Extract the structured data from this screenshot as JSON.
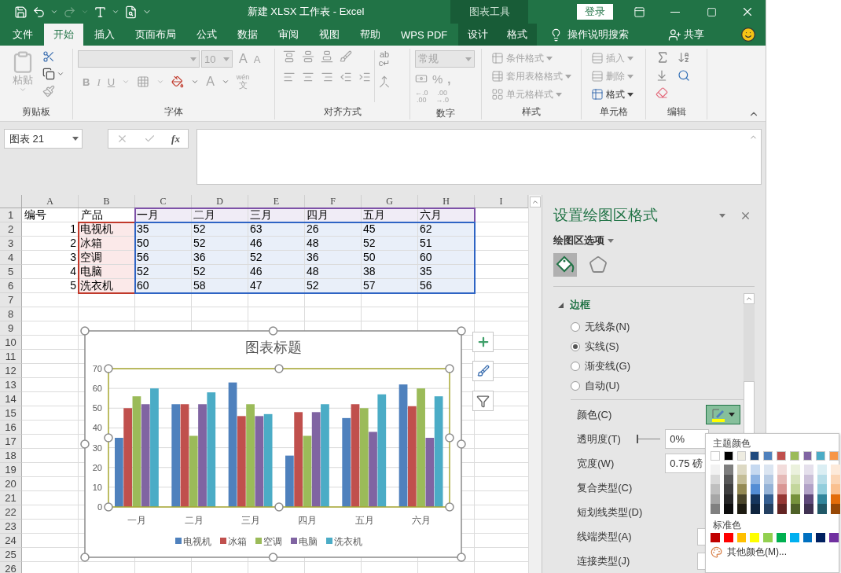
{
  "title_bar": {
    "title": "新建 XLSX 工作表  -  Excel",
    "context_label": "图表工具",
    "login": "登录"
  },
  "tabs": [
    {
      "label": "文件",
      "selected": false,
      "kind": "normal"
    },
    {
      "label": "开始",
      "selected": true,
      "kind": "normal"
    },
    {
      "label": "插入",
      "selected": false,
      "kind": "normal"
    },
    {
      "label": "页面布局",
      "selected": false,
      "kind": "normal"
    },
    {
      "label": "公式",
      "selected": false,
      "kind": "normal"
    },
    {
      "label": "数据",
      "selected": false,
      "kind": "normal"
    },
    {
      "label": "审阅",
      "selected": false,
      "kind": "normal"
    },
    {
      "label": "视图",
      "selected": false,
      "kind": "normal"
    },
    {
      "label": "帮助",
      "selected": false,
      "kind": "normal"
    },
    {
      "label": "WPS PDF",
      "selected": false,
      "kind": "normal"
    },
    {
      "label": "设计",
      "selected": false,
      "kind": "context"
    },
    {
      "label": "格式",
      "selected": false,
      "kind": "context"
    }
  ],
  "tell_me": "操作说明搜索",
  "share": "共享",
  "ribbon": {
    "clipboard": {
      "paste": "粘贴",
      "label": "剪贴板"
    },
    "font": {
      "size": "10",
      "grow": "A",
      "shrink": "A",
      "bold": "B",
      "italic": "I",
      "underline": "U",
      "font_color": "A",
      "phonetic_top": "wén",
      "phonetic_bottom": "文",
      "label": "字体"
    },
    "alignment": {
      "wrap_top": "ab",
      "wrap_bottom": "c↵",
      "label": "对齐方式"
    },
    "number": {
      "format": "常规",
      "percent": "%",
      "comma": ",",
      "increase_top": "←.0",
      "increase_bottom": ".00",
      "decrease_top": ".00",
      "decrease_bottom": "→.0",
      "label": "数字"
    },
    "styles": {
      "items": [
        {
          "label": "条件格式",
          "disabled": true
        },
        {
          "label": "套用表格格式",
          "disabled": true
        },
        {
          "label": "单元格样式",
          "disabled": true
        }
      ],
      "label": "样式"
    },
    "cells": {
      "items": [
        {
          "label": "插入",
          "disabled": true
        },
        {
          "label": "删除",
          "disabled": true
        },
        {
          "label": "格式",
          "disabled": false
        }
      ],
      "label": "单元格"
    },
    "editing": {
      "label": "编辑"
    }
  },
  "formula_bar": {
    "name_box": "图表 21",
    "fx": "fx"
  },
  "sheet": {
    "columns": [
      "A",
      "B",
      "C",
      "D",
      "E",
      "F",
      "G",
      "H",
      "I"
    ],
    "rows": [
      {
        "number": "1",
        "cells": [
          "编号",
          "产品",
          "一月",
          "二月",
          "三月",
          "四月",
          "五月",
          "六月"
        ]
      },
      {
        "number": "2",
        "cells": [
          "1",
          "电视机",
          "35",
          "52",
          "63",
          "26",
          "45",
          "62"
        ]
      },
      {
        "number": "3",
        "cells": [
          "2",
          "冰箱",
          "50",
          "52",
          "46",
          "48",
          "52",
          "51"
        ]
      },
      {
        "number": "4",
        "cells": [
          "3",
          "空调",
          "56",
          "36",
          "52",
          "36",
          "50",
          "60"
        ]
      },
      {
        "number": "5",
        "cells": [
          "4",
          "电脑",
          "52",
          "52",
          "46",
          "48",
          "38",
          "35"
        ]
      },
      {
        "number": "6",
        "cells": [
          "5",
          "洗衣机",
          "60",
          "58",
          "47",
          "52",
          "57",
          "56"
        ]
      },
      {
        "number": "7"
      },
      {
        "number": "8"
      },
      {
        "number": "9"
      },
      {
        "number": "10"
      },
      {
        "number": "11"
      },
      {
        "number": "12"
      },
      {
        "number": "13"
      },
      {
        "number": "14"
      },
      {
        "number": "15"
      },
      {
        "number": "16"
      },
      {
        "number": "17"
      },
      {
        "number": "18"
      },
      {
        "number": "19"
      },
      {
        "number": "20"
      },
      {
        "number": "21"
      },
      {
        "number": "22"
      },
      {
        "number": "23"
      },
      {
        "number": "24"
      },
      {
        "number": "25"
      },
      {
        "number": "26"
      }
    ]
  },
  "chart": {
    "chart_data": {
      "type": "bar",
      "title": "图表标题",
      "categories": [
        "一月",
        "二月",
        "三月",
        "四月",
        "五月",
        "六月"
      ],
      "series": [
        {
          "name": "电视机",
          "color": "#4f81bd",
          "values": [
            35,
            52,
            63,
            26,
            45,
            62
          ]
        },
        {
          "name": "冰箱",
          "color": "#c0504d",
          "values": [
            50,
            52,
            46,
            48,
            52,
            51
          ]
        },
        {
          "name": "空调",
          "color": "#9bbb59",
          "values": [
            56,
            36,
            52,
            36,
            50,
            60
          ]
        },
        {
          "name": "电脑",
          "color": "#8064a2",
          "values": [
            52,
            52,
            46,
            48,
            38,
            35
          ]
        },
        {
          "name": "洗衣机",
          "color": "#4bacc6",
          "values": [
            60,
            58,
            47,
            52,
            57,
            56
          ]
        }
      ],
      "ylim": [
        0,
        70
      ],
      "yticks": [
        {
          "value": 0,
          "label": "0"
        },
        {
          "value": 10,
          "label": "10"
        },
        {
          "value": 20,
          "label": "20"
        },
        {
          "value": 30,
          "label": "30"
        },
        {
          "value": 40,
          "label": "40"
        },
        {
          "value": 50,
          "label": "50"
        },
        {
          "value": 60,
          "label": "60"
        },
        {
          "value": 70,
          "label": "70"
        }
      ],
      "grid": true,
      "legend": true
    }
  },
  "pane": {
    "title": "设置绘图区格式",
    "options": "绘图区选项",
    "icon_tabs": [
      {
        "kind": "fill",
        "selected": true
      },
      {
        "kind": "effects",
        "selected": false
      }
    ],
    "section": {
      "label": "边框",
      "expanded": true
    },
    "radios": [
      {
        "label": "无线条(N)",
        "selected": false
      },
      {
        "label": "实线(S)",
        "selected": true
      },
      {
        "label": "渐变线(G)",
        "selected": false
      },
      {
        "label": "自动(U)",
        "selected": false
      }
    ],
    "properties": [
      {
        "kind": "color",
        "label": "颜色(C)",
        "color": "#ffff00"
      },
      {
        "kind": "slider",
        "label": "透明度(T)",
        "level": 0,
        "value": "0%"
      },
      {
        "kind": "input",
        "label": "宽度(W)",
        "value": "0.75 磅"
      },
      {
        "kind": "plain",
        "label": "复合类型(C)"
      },
      {
        "kind": "plain",
        "label": "短划线类型(D)"
      },
      {
        "kind": "select",
        "label": "线端类型(A)"
      },
      {
        "kind": "select",
        "label": "连接类型(J)"
      }
    ]
  },
  "color_picker": {
    "theme_title": "主题颜色",
    "theme": [
      {
        "color": "#ffffff",
        "shades": [
          {
            "color": "#f2f2f2"
          },
          {
            "color": "#d9d9d9"
          },
          {
            "color": "#bfbfbf"
          },
          {
            "color": "#a6a6a6"
          },
          {
            "color": "#808080"
          }
        ]
      },
      {
        "color": "#000000",
        "shades": [
          {
            "color": "#7f7f7f"
          },
          {
            "color": "#595959"
          },
          {
            "color": "#3f3f3f"
          },
          {
            "color": "#262626"
          },
          {
            "color": "#0d0d0d"
          }
        ]
      },
      {
        "color": "#eeece1",
        "shades": [
          {
            "color": "#ddd9c4"
          },
          {
            "color": "#c4bd97"
          },
          {
            "color": "#948a54"
          },
          {
            "color": "#4a452a"
          },
          {
            "color": "#1d1b10"
          }
        ]
      },
      {
        "color": "#1f497d",
        "shades": [
          {
            "color": "#c6d9f0"
          },
          {
            "color": "#8db3e2"
          },
          {
            "color": "#548dd4"
          },
          {
            "color": "#17365d"
          },
          {
            "color": "#0f243e"
          }
        ]
      },
      {
        "color": "#4f81bd",
        "shades": [
          {
            "color": "#dbe5f1"
          },
          {
            "color": "#b8cce4"
          },
          {
            "color": "#95b3d7"
          },
          {
            "color": "#366092"
          },
          {
            "color": "#244061"
          }
        ]
      },
      {
        "color": "#c0504d",
        "shades": [
          {
            "color": "#f2dcdb"
          },
          {
            "color": "#e5b9b7"
          },
          {
            "color": "#d99694"
          },
          {
            "color": "#953734"
          },
          {
            "color": "#632423"
          }
        ]
      },
      {
        "color": "#9bbb59",
        "shades": [
          {
            "color": "#ebf1dd"
          },
          {
            "color": "#d7e3bc"
          },
          {
            "color": "#c3d69b"
          },
          {
            "color": "#76923c"
          },
          {
            "color": "#4f6128"
          }
        ]
      },
      {
        "color": "#8064a2",
        "shades": [
          {
            "color": "#e5e0ec"
          },
          {
            "color": "#ccc1d9"
          },
          {
            "color": "#b2a2c7"
          },
          {
            "color": "#5f497a"
          },
          {
            "color": "#3f3151"
          }
        ]
      },
      {
        "color": "#4bacc6",
        "shades": [
          {
            "color": "#dbeef3"
          },
          {
            "color": "#b7dde8"
          },
          {
            "color": "#92cddc"
          },
          {
            "color": "#31859b"
          },
          {
            "color": "#205867"
          }
        ]
      },
      {
        "color": "#f79646",
        "shades": [
          {
            "color": "#fdeada"
          },
          {
            "color": "#fbd5b5"
          },
          {
            "color": "#fac08f"
          },
          {
            "color": "#e36c09"
          },
          {
            "color": "#974806"
          }
        ]
      }
    ],
    "standard_title": "标准色",
    "standard": [
      {
        "color": "#c00000"
      },
      {
        "color": "#ff0000"
      },
      {
        "color": "#ffc000"
      },
      {
        "color": "#ffff00"
      },
      {
        "color": "#92d050"
      },
      {
        "color": "#00b050"
      },
      {
        "color": "#00b0f0"
      },
      {
        "color": "#0070c0"
      },
      {
        "color": "#002060"
      },
      {
        "color": "#7030a0"
      }
    ],
    "more": "其他颜色(M)..."
  }
}
